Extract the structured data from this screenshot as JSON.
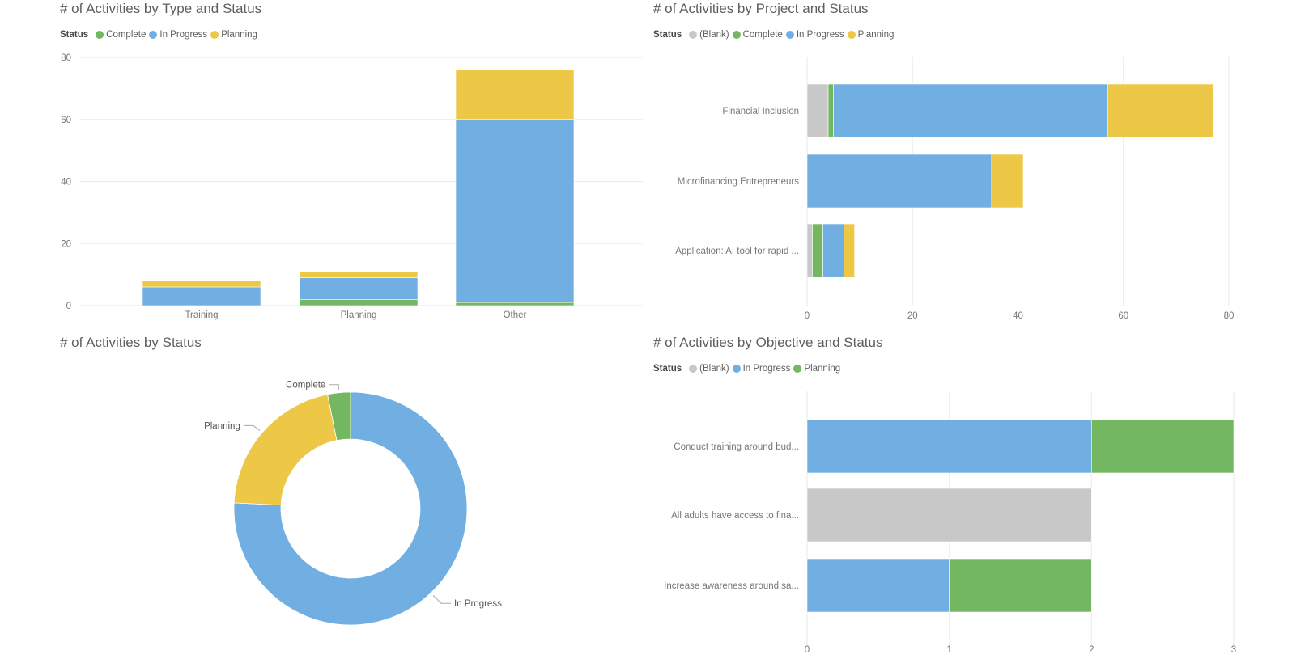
{
  "colors": {
    "blank": "#c8c8c8",
    "complete": "#73b761",
    "in_progress": "#71afe2",
    "planning_yellow": "#ecc846",
    "planning_green": "#73b761",
    "gridline": "#eaeaea",
    "axis_text": "#777777"
  },
  "chart_data": [
    {
      "id": "type-status",
      "type": "bar",
      "stacked": true,
      "orientation": "vertical",
      "title": "# of Activities by Type and Status",
      "legend_title": "Status",
      "legend_position": "top-left",
      "categories": [
        "Training",
        "Planning",
        "Other"
      ],
      "series": [
        {
          "name": "Complete",
          "color": "#73b761",
          "values": [
            0,
            2,
            1
          ]
        },
        {
          "name": "In Progress",
          "color": "#71afe2",
          "values": [
            6,
            7,
            59
          ]
        },
        {
          "name": "Planning",
          "color": "#ecc846",
          "values": [
            2,
            2,
            16
          ]
        }
      ],
      "ylim": [
        0,
        80
      ],
      "yticks": [
        0,
        20,
        40,
        60,
        80
      ],
      "grid": true,
      "xlabel": "",
      "ylabel": ""
    },
    {
      "id": "project-status",
      "type": "bar",
      "stacked": true,
      "orientation": "horizontal",
      "title": "# of Activities by Project and Status",
      "legend_title": "Status",
      "legend_position": "top-left",
      "categories": [
        "Financial Inclusion",
        "Microfinancing Entrepreneurs",
        "Application: AI tool for rapid ..."
      ],
      "series": [
        {
          "name": "(Blank)",
          "color": "#c8c8c8",
          "values": [
            4,
            0,
            1
          ]
        },
        {
          "name": "Complete",
          "color": "#73b761",
          "values": [
            1,
            0,
            2
          ]
        },
        {
          "name": "In Progress",
          "color": "#71afe2",
          "values": [
            52,
            35,
            4
          ]
        },
        {
          "name": "Planning",
          "color": "#ecc846",
          "values": [
            20,
            6,
            2
          ]
        }
      ],
      "xlim": [
        0,
        80
      ],
      "xticks": [
        0,
        20,
        40,
        60,
        80
      ],
      "grid": true,
      "xlabel": "",
      "ylabel": ""
    },
    {
      "id": "status-donut",
      "type": "pie",
      "donut": true,
      "title": "# of Activities by Status",
      "slices": [
        {
          "name": "In Progress",
          "color": "#71afe2",
          "value": 72
        },
        {
          "name": "Planning",
          "color": "#ecc846",
          "value": 20
        },
        {
          "name": "Complete",
          "color": "#73b761",
          "value": 3
        }
      ]
    },
    {
      "id": "objective-status",
      "type": "bar",
      "stacked": true,
      "orientation": "horizontal",
      "title": "# of Activities by Objective and Status",
      "legend_title": "Status",
      "legend_position": "top-left",
      "categories": [
        "Conduct training around bud...",
        "All adults have access to fina...",
        "Increase awareness around sa..."
      ],
      "series": [
        {
          "name": "(Blank)",
          "color": "#c8c8c8",
          "values": [
            0,
            2,
            0
          ]
        },
        {
          "name": "In Progress",
          "color": "#71afe2",
          "values": [
            2,
            0,
            1
          ]
        },
        {
          "name": "Planning",
          "color": "#73b761",
          "values": [
            1,
            0,
            1
          ]
        }
      ],
      "xlim": [
        0,
        3
      ],
      "xticks": [
        0,
        1,
        2,
        3
      ],
      "grid": true,
      "xlabel": "",
      "ylabel": ""
    }
  ]
}
